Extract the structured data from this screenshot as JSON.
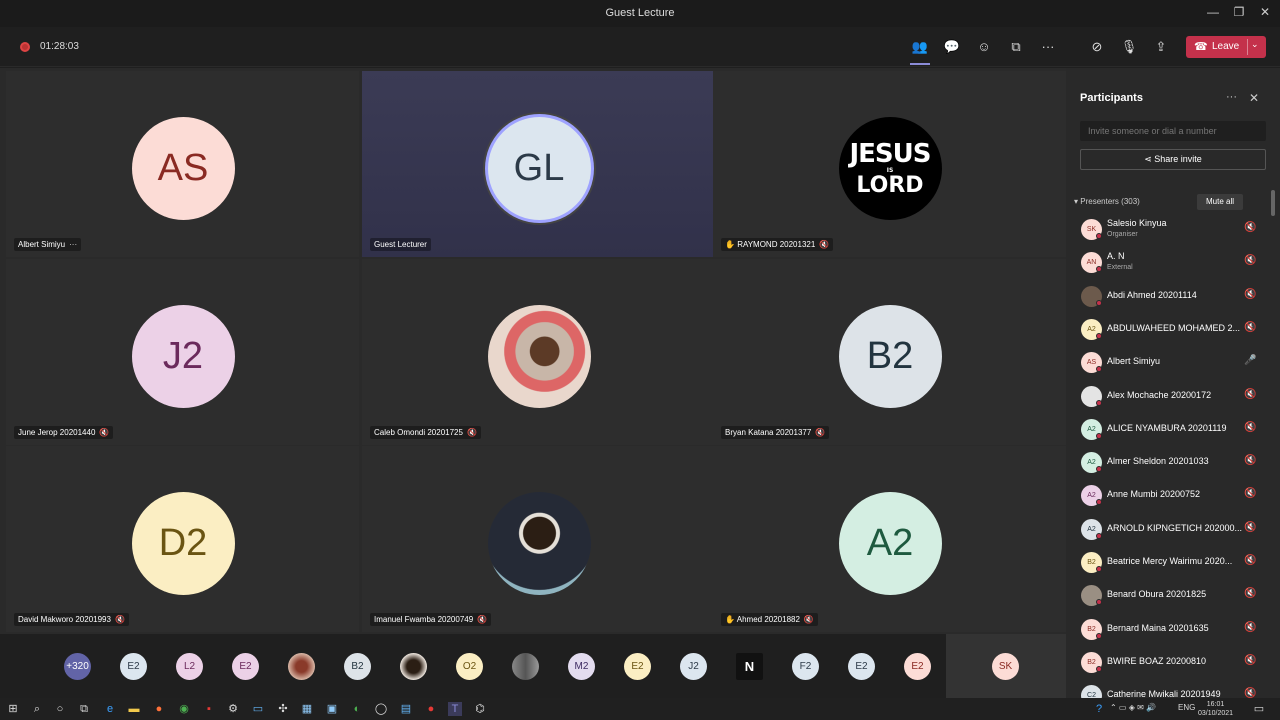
{
  "window": {
    "title": "Guest Lecture",
    "minimize": "—",
    "maximize": "❐",
    "close": "✕"
  },
  "toolbar": {
    "timer": "01:28:03",
    "leave_label": "Leave",
    "leave_color": "#c4314b"
  },
  "tiles": [
    {
      "initials": "AS",
      "name": "Albert Simiyu",
      "suffix": "···",
      "bg": "#fcdcd6",
      "fg": "#8a2a23"
    },
    {
      "initials": "GL",
      "name": "Guest Lecturer",
      "suffix": "",
      "bg": "#dce6ef",
      "fg": "#2c3a48"
    },
    {
      "initials": "",
      "name": "RAYMOND 20201321",
      "suffix": "",
      "logo_top": "JESUS",
      "logo_mid": "IS",
      "logo_bottom": "LORD"
    },
    {
      "initials": "J2",
      "name": "June Jerop 20201440",
      "suffix": "",
      "bg": "#ecd1e7",
      "fg": "#6b2a5c"
    },
    {
      "initials": "",
      "name": "Caleb Omondi 20201725",
      "suffix": ""
    },
    {
      "initials": "B2",
      "name": "Bryan Katana 20201377",
      "suffix": "",
      "bg": "#dde3e8",
      "fg": "#22343f"
    },
    {
      "initials": "D2",
      "name": "David Makworo 20201993",
      "suffix": "",
      "bg": "#fbeec3",
      "fg": "#6a5412"
    },
    {
      "initials": "",
      "name": "Imanuel Fwamba 20200749",
      "suffix": ""
    },
    {
      "initials": "A2",
      "name": "Ahmed 20201882",
      "suffix": "",
      "bg": "#d4eee2",
      "fg": "#1e5a3f"
    }
  ],
  "overflow": {
    "count": "+320",
    "chips": [
      "E2",
      "L2",
      "E2",
      "",
      "B2",
      "",
      "O2",
      "",
      "M2",
      "E2",
      "J2",
      "N",
      "F2",
      "E2",
      "E2"
    ],
    "self": "SK"
  },
  "panel": {
    "title": "Participants",
    "more": "···",
    "close": "✕",
    "invite_placeholder": "Invite someone or dial a number",
    "share_label": "Share invite",
    "presenters_label": "Presenters (303)",
    "mute_all": "Mute all",
    "people": [
      {
        "initials": "SK",
        "name": "Salesio Kinyua",
        "role": "Organiser",
        "bg": "#fcdcd6",
        "fg": "#8a2a23"
      },
      {
        "initials": "AN",
        "name": "A. N",
        "role": "External",
        "bg": "#fcdcd6",
        "fg": "#8a2a23"
      },
      {
        "initials": "",
        "name": "Abdi Ahmed 20201114",
        "role": "",
        "bg": "#6c5a4c",
        "fg": "#fff"
      },
      {
        "initials": "A2",
        "name": "ABDULWAHEED MOHAMED 2...",
        "role": "",
        "bg": "#fbeec3",
        "fg": "#6a5412"
      },
      {
        "initials": "AS",
        "name": "Albert Simiyu",
        "role": "",
        "bg": "#fcdcd6",
        "fg": "#8a2a23",
        "unmuted": true
      },
      {
        "initials": "",
        "name": "Alex Mochache 20200172",
        "role": "",
        "bg": "#e4e4e4",
        "fg": "#222"
      },
      {
        "initials": "A2",
        "name": "ALICE NYAMBURA 20201119",
        "role": "",
        "bg": "#d4eee2",
        "fg": "#1e5a3f"
      },
      {
        "initials": "A2",
        "name": "Almer Sheldon 20201033",
        "role": "",
        "bg": "#d4eee2",
        "fg": "#1e5a3f"
      },
      {
        "initials": "A2",
        "name": "Anne Mumbi 20200752",
        "role": "",
        "bg": "#ecd1e7",
        "fg": "#6b2a5c"
      },
      {
        "initials": "A2",
        "name": "ARNOLD KIPNGETICH 202000...",
        "role": "",
        "bg": "#dde3e8",
        "fg": "#22343f"
      },
      {
        "initials": "B2",
        "name": "Beatrice Mercy Wairimu 2020...",
        "role": "",
        "bg": "#fbeec3",
        "fg": "#6a5412"
      },
      {
        "initials": "",
        "name": "Benard Obura 20201825",
        "role": "",
        "bg": "#9a8f83",
        "fg": "#fff"
      },
      {
        "initials": "B2",
        "name": "Bernard Maina 20201635",
        "role": "",
        "bg": "#fcdcd6",
        "fg": "#8a2a23"
      },
      {
        "initials": "B2",
        "name": "BWIRE BOAZ 20200810",
        "role": "",
        "bg": "#fcdcd6",
        "fg": "#8a2a23"
      },
      {
        "initials": "C2",
        "name": "Catherine Mwikali 20201949",
        "role": "",
        "bg": "#dde3e8",
        "fg": "#22343f"
      }
    ]
  },
  "taskbar": {
    "lang": "ENG",
    "time": "16:01",
    "date": "03/10/2021"
  }
}
